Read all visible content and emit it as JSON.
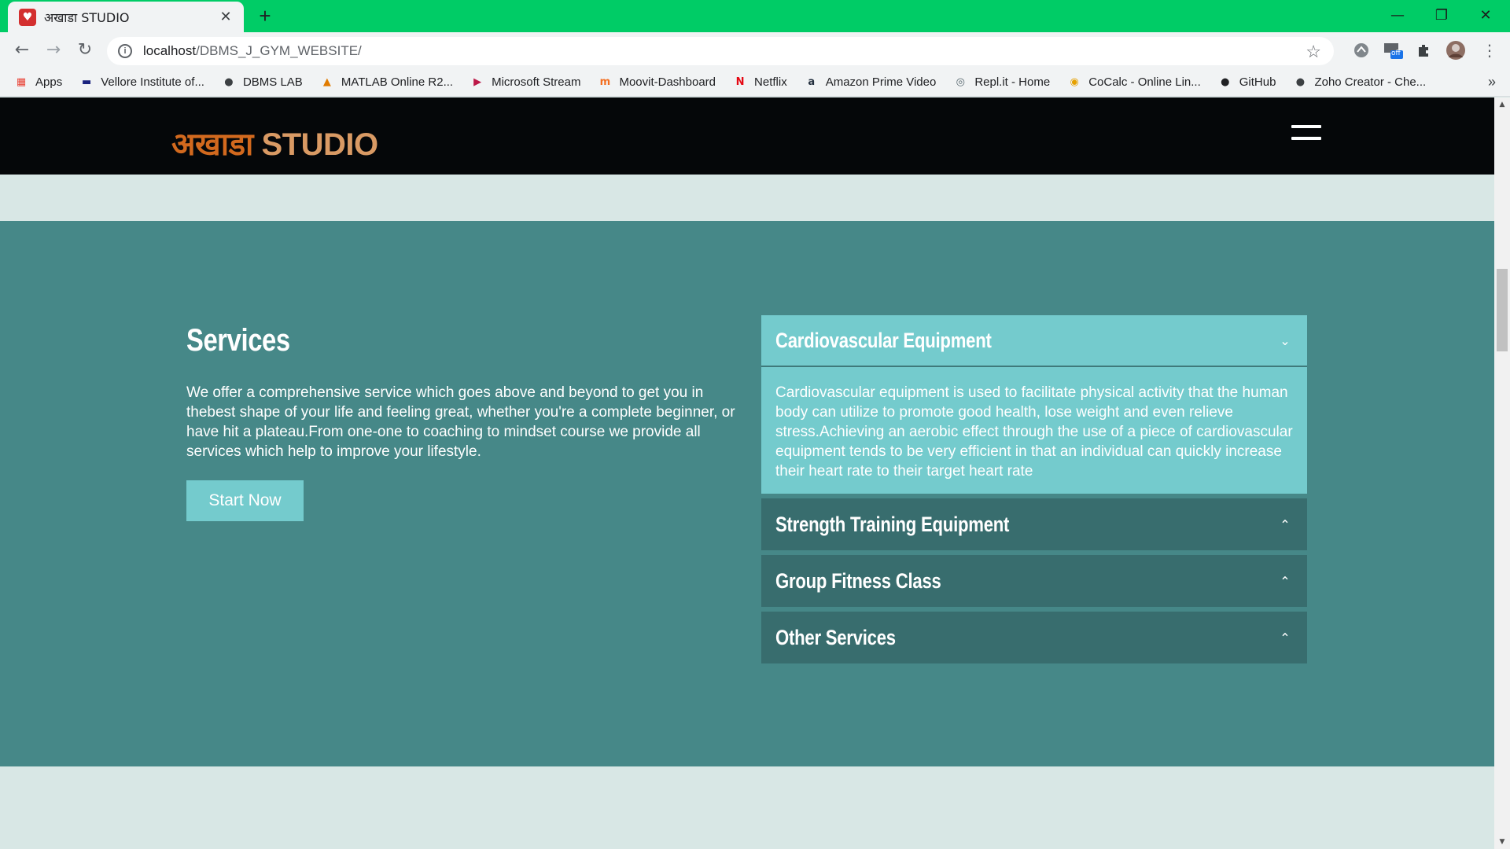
{
  "browser": {
    "tab_title": "अखाडा STUDIO",
    "tab_favicon_glyph": "♥",
    "new_tab_glyph": "+",
    "close_glyph": "✕",
    "window_controls": {
      "minimize": "—",
      "maximize": "❐",
      "close": "✕"
    },
    "url_host": "localhost",
    "url_path": "/DBMS_J_GYM_WEBSITE/",
    "back_glyph": "←",
    "forward_glyph": "→",
    "reload_glyph": "↻",
    "star_glyph": "☆",
    "menu_glyph": "⋮",
    "extension_badge": "off",
    "bookmarks": [
      {
        "label": "Apps",
        "icon": "apps-grid-icon",
        "glyph": "▦",
        "color": "#e94235"
      },
      {
        "label": "Vellore Institute of...",
        "icon": "vit-icon",
        "glyph": "▬",
        "color": "#1a237e"
      },
      {
        "label": "DBMS LAB",
        "icon": "globe-icon",
        "glyph": "●",
        "color": "#3c4043"
      },
      {
        "label": "MATLAB Online R2...",
        "icon": "matlab-icon",
        "glyph": "▲",
        "color": "#e07b00"
      },
      {
        "label": "Microsoft Stream",
        "icon": "stream-icon",
        "glyph": "▶",
        "color": "#bc1948"
      },
      {
        "label": "Moovit-Dashboard",
        "icon": "moovit-icon",
        "glyph": "m",
        "color": "#f36f21"
      },
      {
        "label": "Netflix",
        "icon": "netflix-icon",
        "glyph": "N",
        "color": "#e50914"
      },
      {
        "label": "Amazon Prime Video",
        "icon": "amazon-icon",
        "glyph": "a",
        "color": "#232f3e"
      },
      {
        "label": "Repl.it - Home",
        "icon": "replit-icon",
        "glyph": "◎",
        "color": "#56676e"
      },
      {
        "label": "CoCalc - Online Lin...",
        "icon": "cocalc-icon",
        "glyph": "◉",
        "color": "#e6a100"
      },
      {
        "label": "GitHub",
        "icon": "github-icon",
        "glyph": "●",
        "color": "#202124"
      },
      {
        "label": "Zoho Creator - Che...",
        "icon": "globe-icon",
        "glyph": "●",
        "color": "#3c4043"
      }
    ],
    "bookmarks_more": "»"
  },
  "site": {
    "logo_hindi": "अखाडा",
    "logo_english": " STUDIO"
  },
  "services": {
    "title": "Services",
    "description": "We offer a comprehensive service which goes above and beyond to get you in thebest shape of your life and feeling great, whether you're a complete beginner, or have hit a plateau.From one-one to coaching to mindset course we provide all services which help to improve your lifestyle.",
    "button_label": "Start Now",
    "accordion": [
      {
        "label": "Cardiovascular Equipment",
        "open": true,
        "chevron": "⌄",
        "body": "Cardiovascular equipment is used to facilitate physical activity that the human body can utilize to promote good health, lose weight and even relieve stress.Achieving an aerobic effect through the use of a piece of cardiovascular equipment tends to be very efficient in that an individual can quickly increase their heart rate to their target heart rate"
      },
      {
        "label": "Strength Training Equipment",
        "open": false,
        "chevron": "⌃"
      },
      {
        "label": "Group Fitness Class",
        "open": false,
        "chevron": "⌃"
      },
      {
        "label": "Other Services",
        "open": false,
        "chevron": "⌃"
      }
    ]
  },
  "colors": {
    "tabbar": "#00cc66",
    "nav_bg": "#050709",
    "services_bg": "#468888",
    "accent": "#74cbcd",
    "accordion_closed": "#386d6e",
    "page_bg": "#d8e7e5",
    "logo_orange": "#d2691e"
  }
}
